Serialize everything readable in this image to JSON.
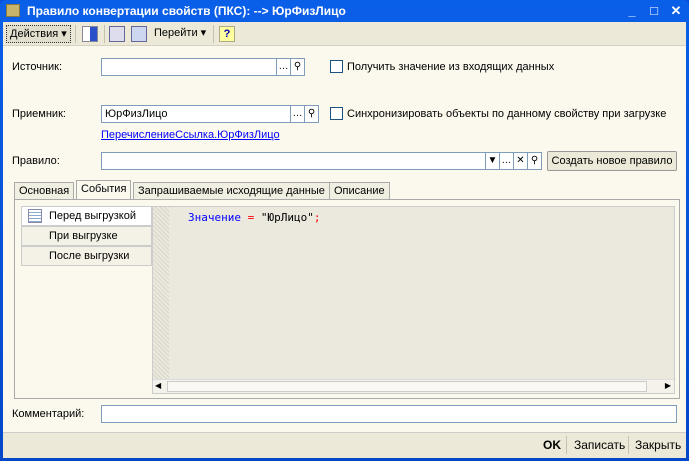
{
  "window": {
    "title": "Правило конвертации свойств (ПКС):  --> ЮрФизЛицо",
    "minimize": "_",
    "maximize": "□",
    "close": "✕"
  },
  "toolbar": {
    "actions": "Действия ▾",
    "goto": "Перейти ▾",
    "help": "?"
  },
  "form": {
    "source_label": "Источник:",
    "source_value": "",
    "source_checkbox": "Получить значение из входящих данных",
    "receiver_label": "Приемник:",
    "receiver_value": "ЮрФизЛицо",
    "receiver_checkbox": "Синхронизировать объекты по данному свойству при загрузке",
    "receiver_type_link": "ПеречислениеСсылка.ЮрФизЛицо",
    "rule_label": "Правило:",
    "rule_value": "",
    "create_rule_button": "Создать новое правило",
    "comment_label": "Комментарий:",
    "comment_value": ""
  },
  "tabs": [
    {
      "label": "Основная"
    },
    {
      "label": "События",
      "active": true
    },
    {
      "label": "Запрашиваемые исходящие данные"
    },
    {
      "label": "Описание"
    }
  ],
  "events": [
    {
      "label": "Перед выгрузкой",
      "active": true
    },
    {
      "label": "При выгрузке"
    },
    {
      "label": "После выгрузки"
    }
  ],
  "code": {
    "ident": "Значение",
    "op": "=",
    "str": "\"ЮрЛицо\"",
    "end": ";"
  },
  "footer": {
    "ok": "OK",
    "save": "Записать",
    "close": "Закрыть"
  },
  "colors": {
    "titlebar": "#0a5fe8",
    "keyword": "#0000ff",
    "operator": "#ff0000"
  }
}
